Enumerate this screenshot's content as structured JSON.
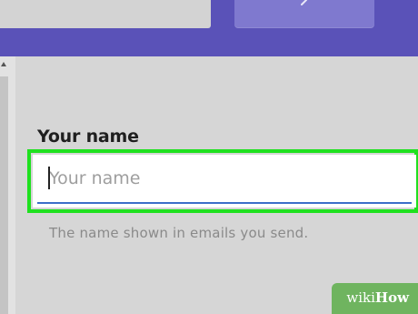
{
  "form": {
    "label": "Your name",
    "input_placeholder": "Your name",
    "input_value": "",
    "help_text": "The name shown in emails you send."
  },
  "header": {
    "button_icon": "chevron-left-icon"
  },
  "colors": {
    "header_bg": "#5a52b8",
    "highlight": "#1fe11f",
    "underline": "#3c6ec8",
    "watermark_bg": "#6fb45f"
  },
  "watermark": {
    "wiki": "wiki",
    "how": "How"
  }
}
